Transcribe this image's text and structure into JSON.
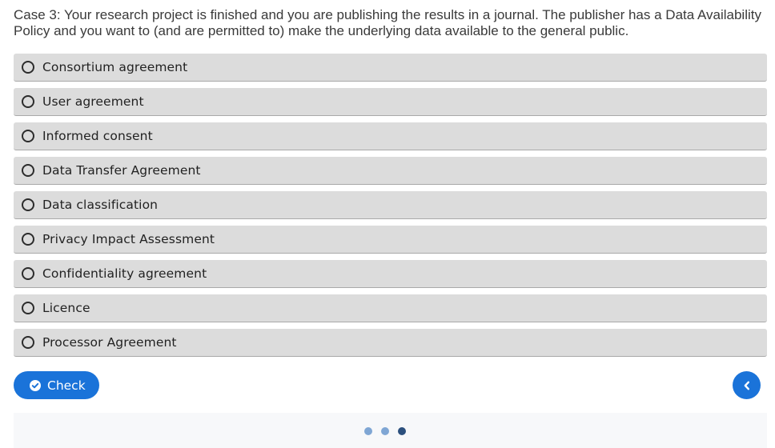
{
  "question": {
    "text": "Case 3: Your research project is finished and you are publishing the results in a journal. The publisher has a Data Availability Policy and you want to (and are permitted to) make the underlying data available to the general public."
  },
  "options": [
    {
      "label": "Consortium agreement"
    },
    {
      "label": "User agreement"
    },
    {
      "label": "Informed consent"
    },
    {
      "label": "Data Transfer Agreement"
    },
    {
      "label": "Data classification"
    },
    {
      "label": "Privacy Impact Assessment"
    },
    {
      "label": "Confidentiality agreement"
    },
    {
      "label": "Licence"
    },
    {
      "label": "Processor Agreement"
    }
  ],
  "actions": {
    "check_label": "Check",
    "check_icon": "check-circle-icon",
    "prev_icon": "chevron-left-icon"
  },
  "pagination": {
    "total": 3,
    "current": 3
  },
  "colors": {
    "accent": "#1a73d9",
    "option_bg": "#dcdcdc",
    "dot_active": "#2b4f7d",
    "dot_inactive": "#7fa6d4"
  }
}
